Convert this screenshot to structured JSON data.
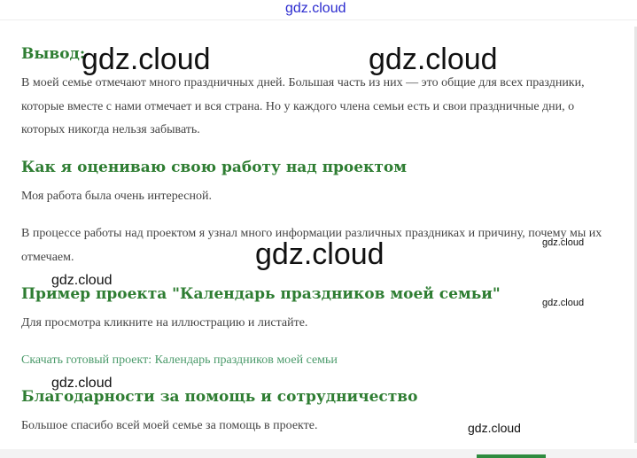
{
  "sections": {
    "vyvod": {
      "heading": "Вывод:",
      "text": "В моей семье отмечают много праздничных дней. Большая часть из них — это общие для всех праздники, которые вместе с нами отмечает и вся страна. Но у каждого члена семьи есть и свои праздничные дни, о которых никогда нельзя забывать."
    },
    "ocenka": {
      "heading": "Как я оцениваю свою работу над проектом",
      "text1": "Моя работа была очень интересной.",
      "text2": "В процессе работы над проектом я узнал много информации различных праздниках и причину, почему мы их отмечаем."
    },
    "primer": {
      "heading": "Пример проекта \"Календарь праздников моей семьи\"",
      "text": "Для просмотра кликните на иллюстрацию и листайте.",
      "download_link": "Скачать готовый проект: Календарь праздников моей семьи"
    },
    "thanks": {
      "heading": "Благодарности за помощь и сотрудничество",
      "text": "Большое спасибо всей моей семье за помощь в проекте."
    }
  },
  "watermark": "gdz.cloud",
  "colors": {
    "heading": "#2e7d32",
    "link": "#4a9a6a",
    "watermark_top": "#2b2bcf"
  }
}
